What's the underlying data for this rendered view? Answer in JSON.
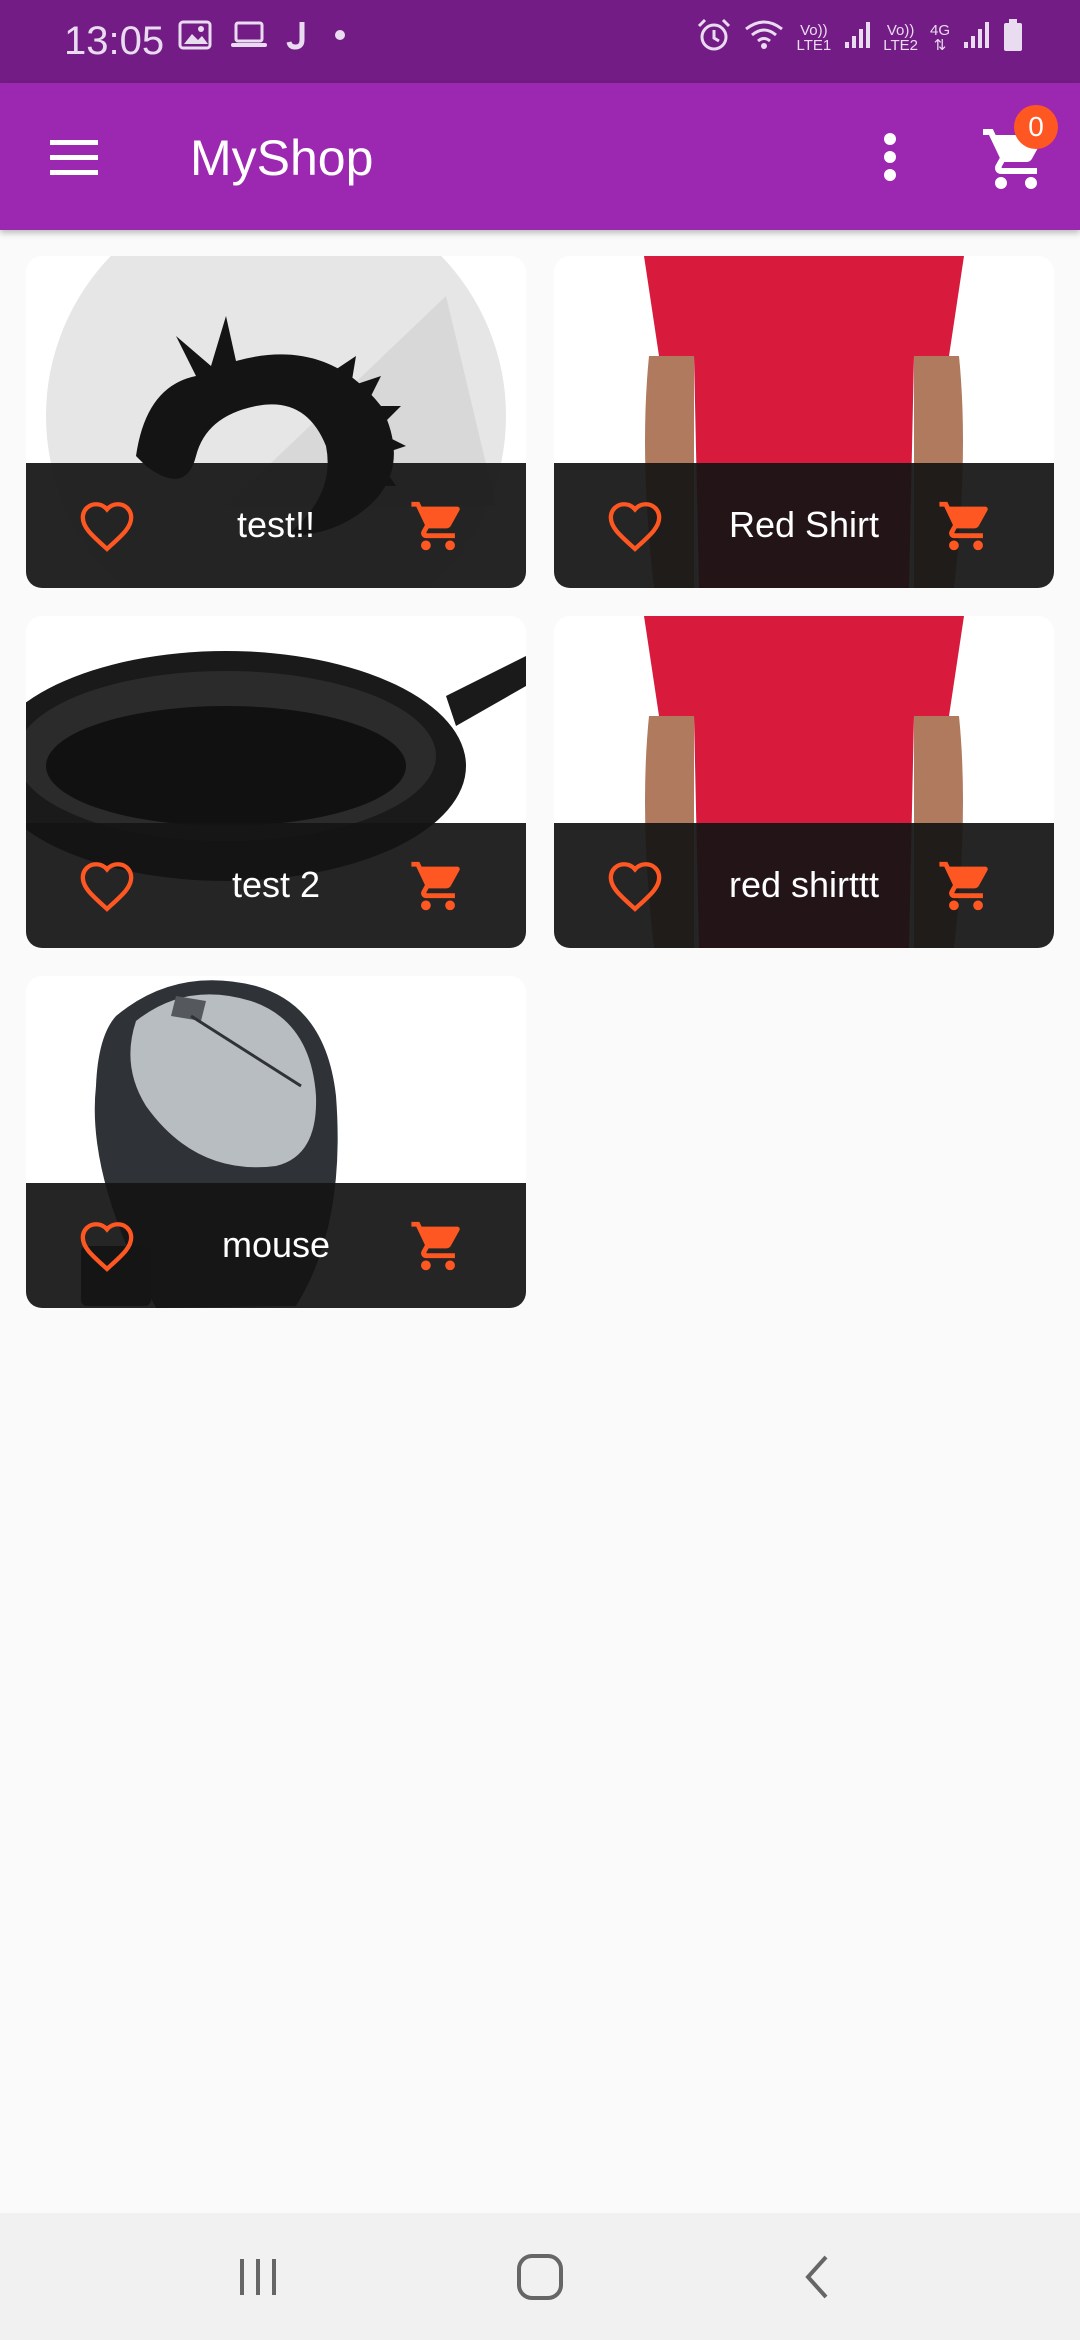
{
  "status_bar": {
    "time": "13:05",
    "icons": [
      "image-icon",
      "laptop-icon",
      "j-icon",
      "dot-icon",
      "alarm-icon",
      "wifi-icon",
      "signal-icon",
      "battery-icon"
    ],
    "sim1_label_top": "Vo))",
    "sim1_label_bottom": "LTE1",
    "sim2_label_top": "Vo))",
    "sim2_label_bottom": "LTE2",
    "net_label": "4G"
  },
  "app_bar": {
    "title": "MyShop",
    "cart_count": "0",
    "accent": "#9c27b0",
    "status_color": "#731c86",
    "badge_color": "#ff5722"
  },
  "products": [
    {
      "title": "test!!",
      "image": "dragon-logo"
    },
    {
      "title": "Red Shirt",
      "image": "red-shirt"
    },
    {
      "title": "test 2",
      "image": "frying-pan"
    },
    {
      "title": "red shirttt",
      "image": "red-shirt"
    },
    {
      "title": "mouse",
      "image": "computer-mouse"
    }
  ],
  "colors": {
    "icon_accent": "#ff5722",
    "card_footer": "#141414"
  },
  "nav": {
    "icons": [
      "recent-apps-icon",
      "home-icon",
      "back-icon"
    ]
  }
}
